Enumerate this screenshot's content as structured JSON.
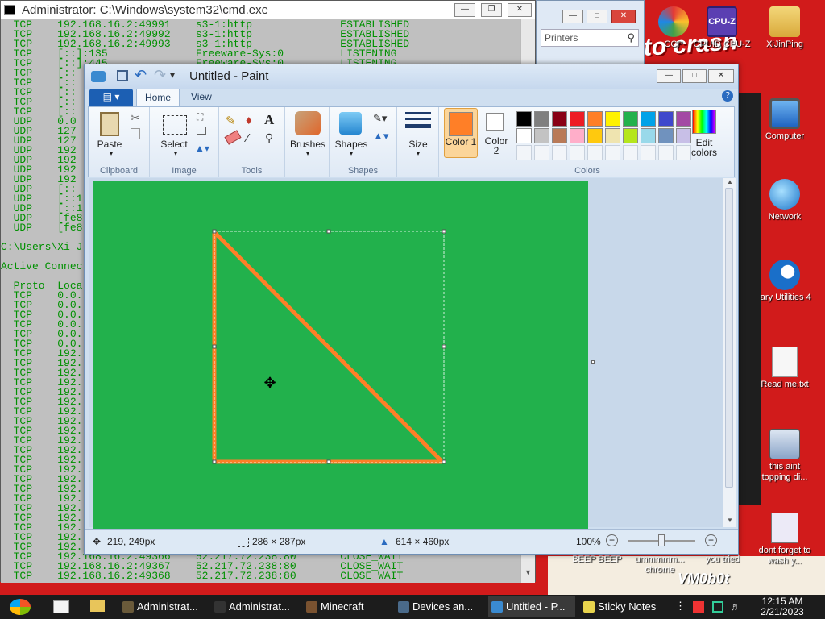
{
  "desktop": {
    "wallpaper_text": "to crash\nnew",
    "icons": [
      {
        "label": "CCP",
        "color": "#e53935"
      },
      {
        "label": "CPUID CPU-Z",
        "color": "#5b3fb2"
      },
      {
        "label": "XiJinPing",
        "color": "#e0c060"
      },
      {
        "label": "Computer",
        "color": "#2f7fd6"
      },
      {
        "label": "Network",
        "color": "#2a9ad8"
      },
      {
        "label": "lary Utilities 4",
        "color": "#1a6fc9"
      },
      {
        "label": "Read me.txt",
        "color": "#f4f4f4"
      },
      {
        "label": "this aint topping di...",
        "color": "#8aa4c8"
      },
      {
        "label": "dont forget to wash y...",
        "color": "#e9e9f6"
      }
    ],
    "bottom_labels": [
      "BEEP BEEP",
      "ummmmm... chrome",
      "you tried",
      "VM0b0t"
    ]
  },
  "cmd": {
    "title": "Administrator: C:\\Windows\\system32\\cmd.exe",
    "lines": [
      "  TCP    192.168.16.2:49991    s3-1:http              ESTABLISHED",
      "  TCP    192.168.16.2:49992    s3-1:http              ESTABLISHED",
      "  TCP    192.168.16.2:49993    s3-1:http              ESTABLISHED",
      "  TCP    [::]:135              Freeware-Sys:0         LISTENING",
      "  TCP    [::]:445              Freeware-Sys:0         LISTENING",
      "  TCP    [::",
      "  TCP    [::",
      "  TCP    [::",
      "  TCP    [::",
      "  TCP    [::",
      "  UDP    0.0",
      "  UDP    127",
      "  UDP    127",
      "  UDP    192",
      "  UDP    192",
      "  UDP    192",
      "  UDP    192",
      "  UDP    [::",
      "  UDP    [::1",
      "  UDP    [::1",
      "  UDP    [fe8",
      "  UDP    [fe8",
      "",
      "C:\\Users\\Xi J",
      "",
      "Active Connec",
      "",
      "  Proto  Loca",
      "  TCP    0.0.",
      "  TCP    0.0.",
      "  TCP    0.0.",
      "  TCP    0.0.",
      "  TCP    0.0.",
      "  TCP    0.0.",
      "  TCP    192.",
      "  TCP    192.",
      "  TCP    192.",
      "  TCP    192.",
      "  TCP    192.",
      "  TCP    192.",
      "  TCP    192.",
      "  TCP    192.",
      "  TCP    192.",
      "  TCP    192.",
      "  TCP    192.",
      "  TCP    192.",
      "  TCP    192.",
      "  TCP    192.",
      "  TCP    192.",
      "  TCP    192.",
      "  TCP    192.",
      "  TCP    192.",
      "  TCP    192.",
      "  TCP    192.",
      "  TCP    192.",
      "  TCP    192.168.16.2:49366    52.217.72.238:80       CLOSE_WAIT",
      "  TCP    192.168.16.2:49367    52.217.72.238:80       CLOSE_WAIT",
      "  TCP    192.168.16.2:49368    52.217.72.238:80       CLOSE_WAIT"
    ]
  },
  "printers_window": {
    "search_placeholder": "Printers"
  },
  "paint": {
    "title": "Untitled - Paint",
    "tabs": [
      "Home",
      "View"
    ],
    "groups": {
      "clipboard": "Clipboard",
      "image": "Image",
      "tools": "Tools",
      "shapes": "Shapes",
      "colors": "Colors"
    },
    "buttons": {
      "paste": "Paste",
      "select": "Select",
      "brushes": "Brushes",
      "shapes": "Shapes",
      "size": "Size",
      "color1": "Color 1",
      "color2": "Color 2",
      "edit_colors": "Edit colors"
    },
    "color1": "#ff7f27",
    "color2": "#ffffff",
    "canvas_color": "#22b14c",
    "stroke_color": "#ff7f27",
    "palette_row1": [
      "#000000",
      "#7f7f7f",
      "#880015",
      "#ed1c24",
      "#ff7f27",
      "#fff200",
      "#22b14c",
      "#00a2e8",
      "#3f48cc",
      "#a349a4"
    ],
    "palette_row2": [
      "#ffffff",
      "#c3c3c3",
      "#b97a57",
      "#ffaec9",
      "#ffc90e",
      "#efe4b0",
      "#b5e61d",
      "#99d9ea",
      "#7092be",
      "#c8bfe7"
    ],
    "status": {
      "cursor_pos": "219, 249px",
      "selection_size": "286 × 287px",
      "image_size": "614 × 460px",
      "zoom": "100%"
    }
  },
  "taskbar": {
    "buttons": [
      {
        "label": "Administrat...",
        "color": "#6a5a3a"
      },
      {
        "label": "Administrat...",
        "color": "#333333"
      },
      {
        "label": "Minecraft",
        "color": "#7a5230"
      },
      {
        "label": "Devices an...",
        "color": "#4a6a8a"
      },
      {
        "label": "Untitled - P...",
        "color": "#3a8ad0"
      },
      {
        "label": "Sticky Notes",
        "color": "#e8d44d"
      }
    ],
    "time": "12:15 AM",
    "date": "2/21/2023"
  }
}
